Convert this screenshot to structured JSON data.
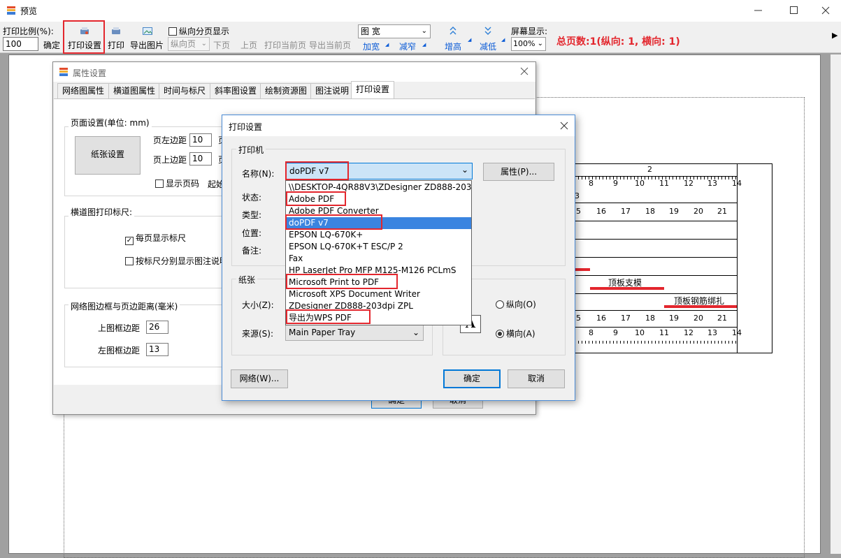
{
  "window": {
    "title": "预览"
  },
  "toolbar": {
    "scale_label": "打印比例(%):",
    "scale_value": "100",
    "confirm": "确定",
    "print_setup": "打印设置",
    "print": "打印",
    "export_image": "导出图片",
    "vertical_paging": "纵向分页显示",
    "vertical_select": "纵向页",
    "next_page": "下页",
    "prev_page": "上页",
    "print_current": "打印当前页",
    "export_current": "导出当前页",
    "width_select": "图 宽",
    "widen": "加宽",
    "narrow": "减窄",
    "increase_height": "增高",
    "decrease_height": "减低",
    "screen_display": "屏幕显示:",
    "zoom": "100%",
    "total_pages": "总页数:1(纵向: 1, 横向: 1)"
  },
  "prop_dialog": {
    "title": "属性设置",
    "tabs": [
      "网络图属性",
      "横道图属性",
      "时间与标尺",
      "斜率图设置",
      "绘制资源图",
      "图注说明",
      "打印设置"
    ],
    "page_group": "页面设置(单位: mm)",
    "paper_button": "纸张设置",
    "left_margin_label": "页左边距",
    "left_margin": "10",
    "top_margin_label": "页上边距",
    "top_margin": "10",
    "cut_char_1": "页",
    "cut_char_2": "页",
    "show_page_no": "显示页码",
    "start_cut": "起始",
    "ruler_group": "横道图打印标尺:",
    "each_page_ruler": "每页显示标尺",
    "split_by_ruler": "按标尺分别显示图注说明",
    "border_group": "网络图边框与页边距离(毫米)",
    "top_border_label": "上图框边距",
    "top_border": "26",
    "left_border_label": "左图框边距",
    "left_border": "13",
    "ok_partial": "确定",
    "cancel_partial": "取消"
  },
  "print_dialog": {
    "title": "打印设置",
    "printer_group": "打印机",
    "name_label": "名称(N):",
    "name_value": "doPDF v7",
    "properties": "属性(P)...",
    "status_label": "状态:",
    "type_label": "类型:",
    "where_label": "位置:",
    "comment_label": "备注:",
    "paper_group": "纸张",
    "size_label": "大小(Z):",
    "source_label": "来源(S):",
    "source_value": "Main Paper Tray",
    "portrait": "纵向(O)",
    "landscape": "横向(A)",
    "orientation_glyph": "A",
    "network": "网络(W)...",
    "ok": "确定",
    "cancel": "取消",
    "printers": [
      "\\\\DESKTOP-4QR88V3\\ZDesigner ZD888-203dpi ZPL",
      "Adobe PDF",
      "Adobe PDF Converter",
      "doPDF v7",
      "EPSON LQ-670K+",
      "EPSON LQ-670K+T ESC/P 2",
      "Fax",
      "HP LaserJet Pro MFP M125-M126 PCLmS",
      "Microsoft Print to PDF",
      "Microsoft XPS Document Writer",
      "ZDesigner ZD888-203dpi ZPL",
      "导出为WPS PDF"
    ]
  },
  "gantt": {
    "header_num": "2",
    "ruler_ticks": [
      "8",
      "9",
      "10",
      "11",
      "12",
      "13",
      "14"
    ],
    "day_cols": [
      "5",
      "16",
      "17",
      "18",
      "19",
      "20",
      "21"
    ],
    "partial_label": "3",
    "task1": "顶板支模",
    "task2": "顶板钢筋绑扎"
  }
}
